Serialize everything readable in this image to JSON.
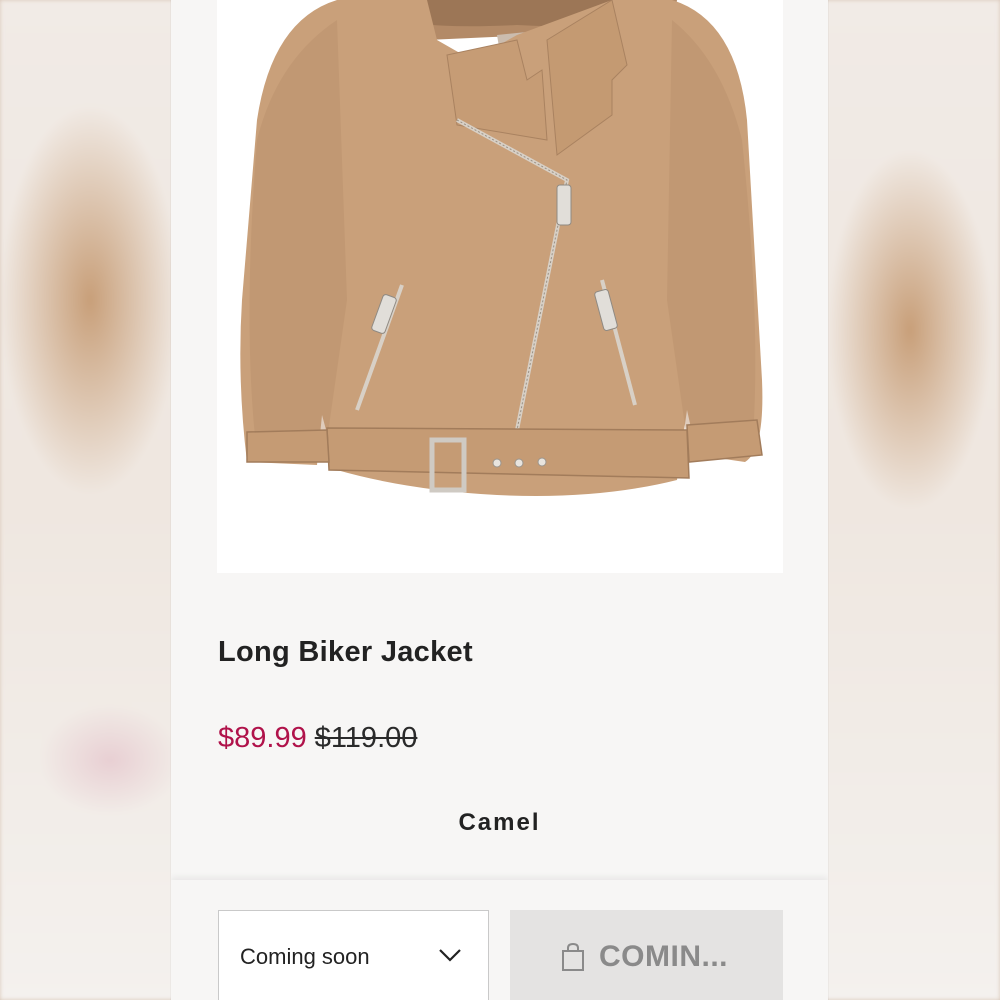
{
  "product": {
    "title": "Long Biker Jacket",
    "sale_price": "$89.99",
    "original_price": "$119.00",
    "color": "Camel"
  },
  "size_select": {
    "selected": "Coming soon"
  },
  "add_button": {
    "label": "COMIN..."
  },
  "colors": {
    "sale": "#b0124a",
    "button_bg": "#e4e3e2",
    "jacket": "#c9a07a"
  },
  "icons": {
    "dropdown": "chevron-down-icon",
    "bag": "shopping-bag-icon"
  }
}
